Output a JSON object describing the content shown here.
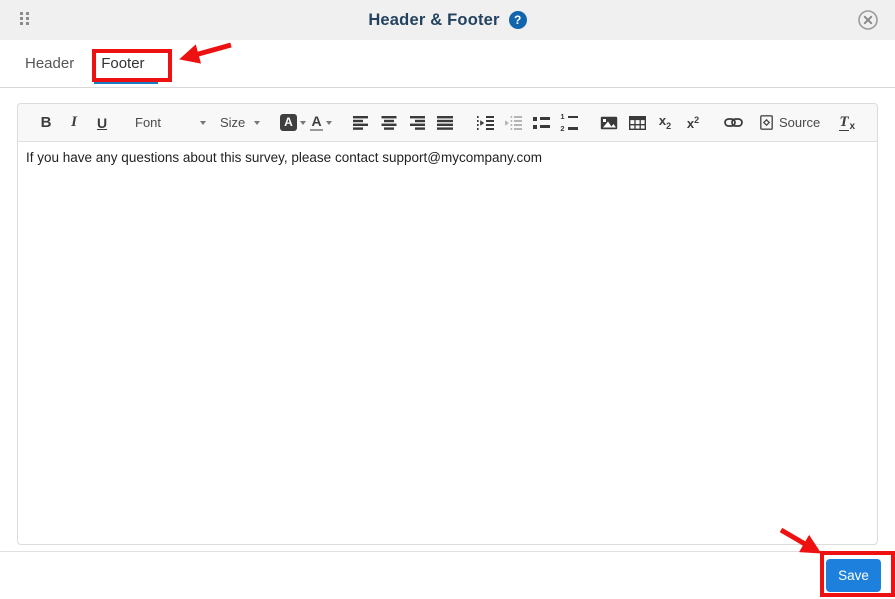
{
  "titlebar": {
    "title": "Header & Footer",
    "help": "?"
  },
  "tabs": {
    "header": "Header",
    "footer": "Footer"
  },
  "toolbar": {
    "bold": "B",
    "italic": "I",
    "underline": "U",
    "font": "Font",
    "size": "Size",
    "bg_color": "A",
    "text_color": "A",
    "numbered_1": "1",
    "numbered_2": "2",
    "subscript_base": "x",
    "subscript_mark": "2",
    "superscript_base": "x",
    "superscript_mark": "2",
    "source": "Source",
    "remove_format_base": "T",
    "remove_format_mark": "x"
  },
  "editor": {
    "content": "If you have any questions about this survey, please contact support@mycompany.com"
  },
  "footer_bar": {
    "save": "Save"
  },
  "colors": {
    "titlebar_bg": "#f0f0f0",
    "title_text": "#24425f",
    "help_icon_blue": "#1265ad",
    "active_tab_underline": "#1a7dc4",
    "annotation_red": "#ee1111",
    "save_button_blue": "#1e80dd",
    "toolbar_bg": "#f8f8f8",
    "editor_border": "#dcdcdc"
  }
}
